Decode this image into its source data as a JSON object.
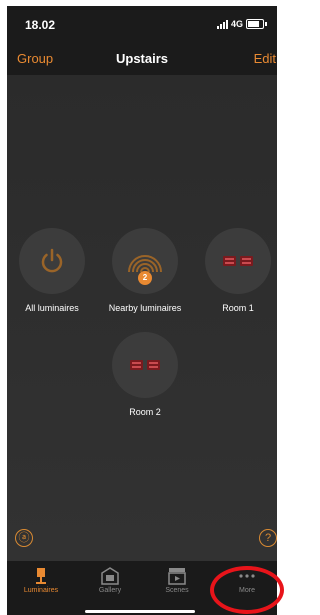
{
  "status_bar": {
    "time": "18.02",
    "network": "4G"
  },
  "nav": {
    "left": "Group",
    "title": "Upstairs",
    "right": "Edit"
  },
  "tiles": [
    {
      "label": "All luminaires",
      "icon": "power-icon"
    },
    {
      "label": "Nearby luminaires",
      "icon": "nearby-signal-icon",
      "badge": "2"
    },
    {
      "label": "Room 1",
      "icon": "room-icon"
    },
    {
      "label": "Room 2",
      "icon": "room-icon"
    }
  ],
  "corner_left_glyph": "ⓐ",
  "corner_right_glyph": "?",
  "tabbar": [
    {
      "label": "Luminaires",
      "icon": "lamp-icon",
      "active": true
    },
    {
      "label": "Gallery",
      "icon": "gallery-icon"
    },
    {
      "label": "Scenes",
      "icon": "clapperboard-icon"
    },
    {
      "label": "More",
      "icon": "more-dots-icon"
    }
  ],
  "colors": {
    "accent": "#e98a32",
    "background": "#2a2a2a",
    "highlight": "#e8141a"
  }
}
